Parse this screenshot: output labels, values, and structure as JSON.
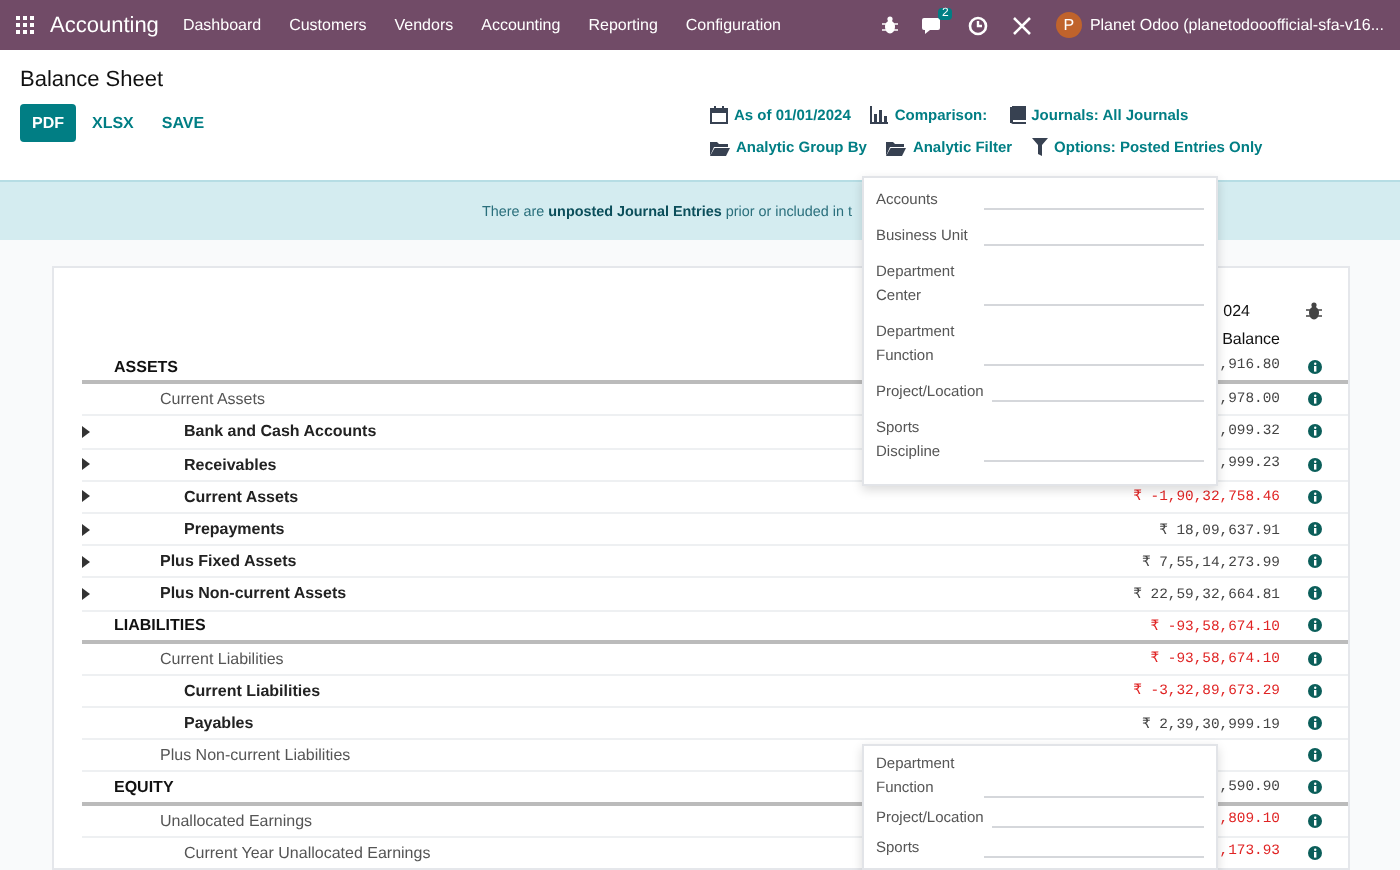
{
  "navbar": {
    "app_name": "Accounting",
    "menus": [
      "Dashboard",
      "Customers",
      "Vendors",
      "Accounting",
      "Reporting",
      "Configuration"
    ],
    "chat_badge": "2",
    "avatar_letter": "P",
    "user": "Planet Odoo (planetodooofficial-sfa-v16..."
  },
  "control_panel": {
    "title": "Balance Sheet",
    "buttons": [
      {
        "label": "PDF",
        "primary": true
      },
      {
        "label": "XLSX",
        "primary": false
      },
      {
        "label": "SAVE",
        "primary": false
      }
    ],
    "filter_rows": [
      [
        {
          "kind": "calendar",
          "label": "As of 01/01/2024"
        },
        {
          "kind": "chart",
          "label": "Comparison:"
        },
        {
          "kind": "book",
          "label": "Journals: All Journals"
        }
      ],
      [
        {
          "kind": "folder",
          "label": "Analytic Group By"
        },
        {
          "kind": "folder",
          "label": "Analytic Filter"
        },
        {
          "kind": "filter",
          "label": "Options: Posted Entries Only"
        }
      ]
    ]
  },
  "alert": {
    "text": "There are **unposted Journal Entries** prior or included in t"
  },
  "report": {
    "period": "024",
    "column": "Balance",
    "lines": [
      {
        "name": "ASSETS",
        "kind": "header",
        "expandable": false,
        "value": ",916.80",
        "negative": false,
        "children": [
          {
            "name": "Current Assets",
            "kind": "group",
            "expandable": false,
            "value": ",978.00",
            "negative": false,
            "children": [
              {
                "name": "Bank and Cash Accounts",
                "kind": "account",
                "expandable": true,
                "value": ",099.32",
                "negative": false
              },
              {
                "name": "Receivables",
                "kind": "account",
                "expandable": true,
                "value": ",999.23",
                "negative": false
              },
              {
                "name": "Current Assets",
                "kind": "account",
                "expandable": true,
                "value": "₹ -1,90,32,758.46",
                "negative": true
              },
              {
                "name": "Prepayments",
                "kind": "account",
                "expandable": true,
                "value": "₹ 18,09,637.91",
                "negative": false
              }
            ]
          },
          {
            "name": "Plus Fixed Assets",
            "kind": "account",
            "expandable": true,
            "value": "₹ 7,55,14,273.99",
            "negative": false
          },
          {
            "name": "Plus Non-current Assets",
            "kind": "account",
            "expandable": true,
            "value": "₹ 22,59,32,664.81",
            "negative": false
          }
        ]
      },
      {
        "name": "LIABILITIES",
        "kind": "header",
        "expandable": false,
        "value": "₹ -93,58,674.10",
        "negative": true,
        "children": [
          {
            "name": "Current Liabilities",
            "kind": "group",
            "expandable": false,
            "value": "₹ -93,58,674.10",
            "negative": true,
            "children": [
              {
                "name": "Current Liabilities",
                "kind": "account",
                "expandable": false,
                "value": "₹ -3,32,89,673.29",
                "negative": true
              },
              {
                "name": "Payables",
                "kind": "account",
                "expandable": false,
                "value": "₹ 2,39,30,999.19",
                "negative": false
              }
            ]
          },
          {
            "name": "Plus Non-current Liabilities",
            "kind": "group",
            "expandable": false
          }
        ]
      },
      {
        "name": "EQUITY",
        "kind": "header",
        "expandable": false,
        "value": ",590.90",
        "negative": false,
        "children": [
          {
            "name": "Unallocated Earnings",
            "kind": "group",
            "expandable": false,
            "value": ",809.10",
            "negative": true,
            "children": [
              {
                "name": "Current Year Unallocated Earnings",
                "kind": "group",
                "expandable": false,
                "value": ",173.93",
                "negative": true
              }
            ]
          }
        ]
      }
    ]
  },
  "dropdowns": [
    {
      "items": [
        "Accounts",
        "Business Unit",
        "Department Center",
        "Department Function",
        "Project/Location",
        "Sports Discipline"
      ]
    },
    {
      "items": [
        "Department Function",
        "Project/Location",
        "Sports"
      ]
    }
  ]
}
